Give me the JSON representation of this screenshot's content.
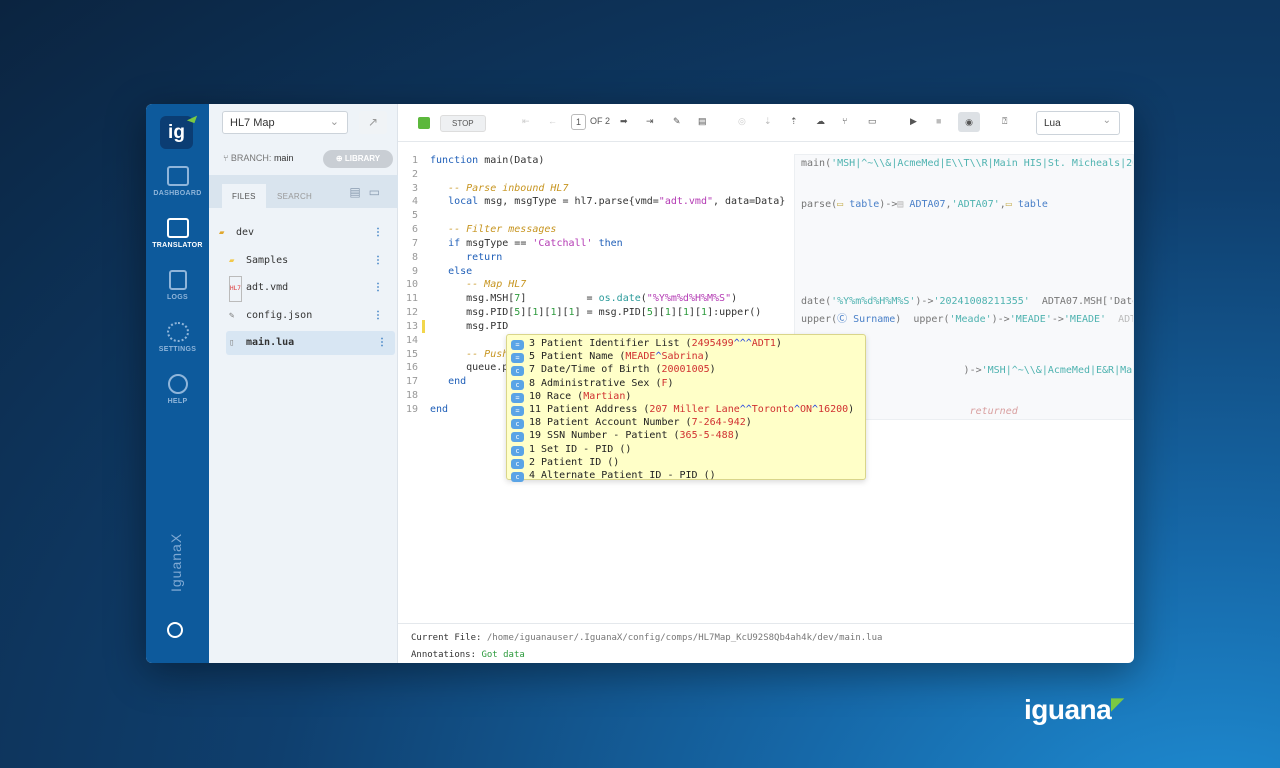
{
  "nav": {
    "items": [
      {
        "label": "DASHBOARD"
      },
      {
        "label": "TRANSLATOR"
      },
      {
        "label": "LOGS"
      },
      {
        "label": "SETTINGS"
      },
      {
        "label": "HELP"
      }
    ],
    "brand": "IguanaX",
    "logo": "ig"
  },
  "files": {
    "component": "HL7 Map",
    "branch_label": "BRANCH:",
    "branch": "main",
    "library": "LIBRARY",
    "tabs": [
      "FILES",
      "SEARCH"
    ],
    "tree": [
      {
        "name": "dev"
      },
      {
        "name": "Samples"
      },
      {
        "name": "adt.vmd"
      },
      {
        "name": "config.json"
      },
      {
        "name": "main.lua"
      }
    ]
  },
  "toolbar": {
    "stop": "STOP",
    "page": "1",
    "of": "OF 2",
    "language": "Lua"
  },
  "code": {
    "lines": [
      "1",
      "2",
      "3",
      "4",
      "5",
      "6",
      "7",
      "8",
      "9",
      "10",
      "11",
      "12",
      "13",
      "14",
      "15",
      "16",
      "17",
      "18",
      "19"
    ]
  },
  "popup": [
    {
      "label": "3 Patient Identifier List",
      "value": "2495499^^^ADT1"
    },
    {
      "label": "5 Patient Name",
      "value": "MEADE^Sabrina"
    },
    {
      "label": "7 Date/Time of Birth",
      "value": "20001005"
    },
    {
      "label": "8 Administrative Sex",
      "value": "F"
    },
    {
      "label": "10 Race",
      "value": "Martian"
    },
    {
      "label": "11 Patient Address",
      "value": "207 Miller Lane^^Toronto^ON^16200"
    },
    {
      "label": "18 Patient Account Number",
      "value": "7-264-942"
    },
    {
      "label": "19 SSN Number - Patient",
      "value": "365-5-488"
    },
    {
      "label": "1 Set ID - PID",
      "value": ""
    },
    {
      "label": "2 Patient ID",
      "value": ""
    },
    {
      "label": "4 Alternate Patient ID - PID",
      "value": ""
    }
  ],
  "status": {
    "current_label": "Current File:",
    "current": "/home/iguanauser/.IguanaX/config/comps/HL7Map_KcU92S8Qb4ah4k/dev/main.lua",
    "anno_label": "Annotations:",
    "anno": "Got data"
  },
  "brand": "iguana"
}
